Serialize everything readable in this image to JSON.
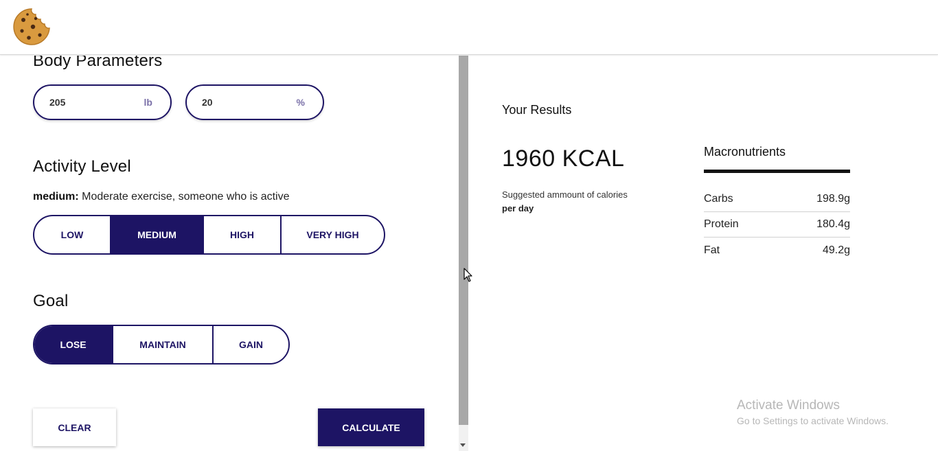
{
  "header": {
    "logo_icon": "cookie-icon"
  },
  "body_parameters": {
    "title": "Body Parameters",
    "weight": {
      "value": "205",
      "unit": "lb"
    },
    "body_fat": {
      "value": "20",
      "unit": "%"
    }
  },
  "activity": {
    "title": "Activity Level",
    "selected_label": "medium:",
    "selected_description": "Moderate exercise, someone who is active",
    "options": [
      "LOW",
      "MEDIUM",
      "HIGH",
      "VERY HIGH"
    ],
    "active": "MEDIUM"
  },
  "goal": {
    "title": "Goal",
    "options": [
      "LOSE",
      "MAINTAIN",
      "GAIN"
    ],
    "active": "LOSE"
  },
  "actions": {
    "clear_label": "CLEAR",
    "calculate_label": "CALCULATE"
  },
  "results": {
    "title": "Your Results",
    "kcal": "1960 KCAL",
    "subtitle": "Suggested ammount of calories",
    "subtitle_bold": "per day"
  },
  "macros": {
    "title": "Macronutrients",
    "rows": [
      {
        "label": "Carbs",
        "value": "198.9g"
      },
      {
        "label": "Protein",
        "value": "180.4g"
      },
      {
        "label": "Fat",
        "value": "49.2g"
      }
    ]
  },
  "watermark": {
    "line1": "Activate Windows",
    "line2": "Go to Settings to activate Windows."
  },
  "colors": {
    "accent": "#1d1464"
  }
}
